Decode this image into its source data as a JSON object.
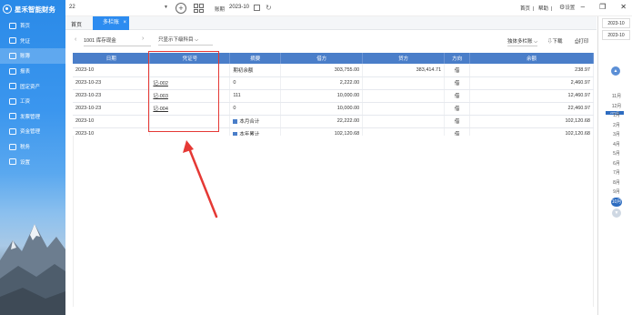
{
  "sidebar": {
    "brand": "星禾智能财务",
    "items": [
      {
        "label": "首页",
        "icon": "home-icon"
      },
      {
        "label": "凭证",
        "icon": "voucher-icon"
      },
      {
        "label": "账簿",
        "icon": "ledger-icon"
      },
      {
        "label": "报表",
        "icon": "report-icon"
      },
      {
        "label": "固定资产",
        "icon": "asset-icon"
      },
      {
        "label": "工资",
        "icon": "salary-icon"
      },
      {
        "label": "发票管理",
        "icon": "invoice-icon"
      },
      {
        "label": "资金管理",
        "icon": "fund-icon"
      },
      {
        "label": "税务",
        "icon": "tax-icon"
      },
      {
        "label": "设置",
        "icon": "settings-icon"
      }
    ],
    "active_index": 2
  },
  "topbar": {
    "account": "22",
    "period_label": "账期",
    "period_value": "2023-10",
    "links": [
      "首页",
      "帮助"
    ],
    "settings_label": "设置"
  },
  "tabs": {
    "home": "首页",
    "active": "多栏账",
    "close": "×"
  },
  "filter": {
    "account": "1001 库存现金",
    "option": "只显示下级科目",
    "multi": "独体多栏账",
    "download": "下载",
    "print": "打印"
  },
  "table": {
    "headers": [
      "日期",
      "凭证号",
      "摘要",
      "借方",
      "贷方",
      "方向",
      "余额"
    ],
    "rows": [
      {
        "date": "2023-10",
        "voucher": "",
        "summary": "期初余额",
        "debit": "303,755.00",
        "credit": "383,414.71",
        "dir": "借",
        "balance": "238.97",
        "sum_icon": false
      },
      {
        "date": "2023-10-23",
        "voucher": "记-002",
        "summary": "0",
        "debit": "2,222.00",
        "credit": "",
        "dir": "借",
        "balance": "2,460.97",
        "sum_icon": false
      },
      {
        "date": "2023-10-23",
        "voucher": "记-003",
        "summary": "111",
        "debit": "10,000.00",
        "credit": "",
        "dir": "借",
        "balance": "12,460.97",
        "sum_icon": false
      },
      {
        "date": "2023-10-23",
        "voucher": "记-004",
        "summary": "0",
        "debit": "10,000.00",
        "credit": "",
        "dir": "借",
        "balance": "22,460.97",
        "sum_icon": false
      },
      {
        "date": "2023-10",
        "voucher": "",
        "summary": "本月合计",
        "debit": "22,222.00",
        "credit": "",
        "dir": "借",
        "balance": "102,120.68",
        "sum_icon": true
      },
      {
        "date": "2023-10",
        "voucher": "",
        "summary": "本年累计",
        "debit": "102,120.68",
        "credit": "",
        "dir": "借",
        "balance": "102,120.68",
        "sum_icon": true
      }
    ]
  },
  "right_panel": {
    "period_from": "2023-10",
    "period_to": "2023-10",
    "year_badge": "2023年",
    "months": [
      "11月",
      "12月",
      "1月",
      "2月",
      "3月",
      "4月",
      "5月",
      "6月",
      "7月",
      "8月",
      "9月"
    ],
    "selected_month": "10月"
  },
  "colors": {
    "accent": "#2d8cf0",
    "header": "#4a7ec9",
    "annotation": "#e53935"
  }
}
